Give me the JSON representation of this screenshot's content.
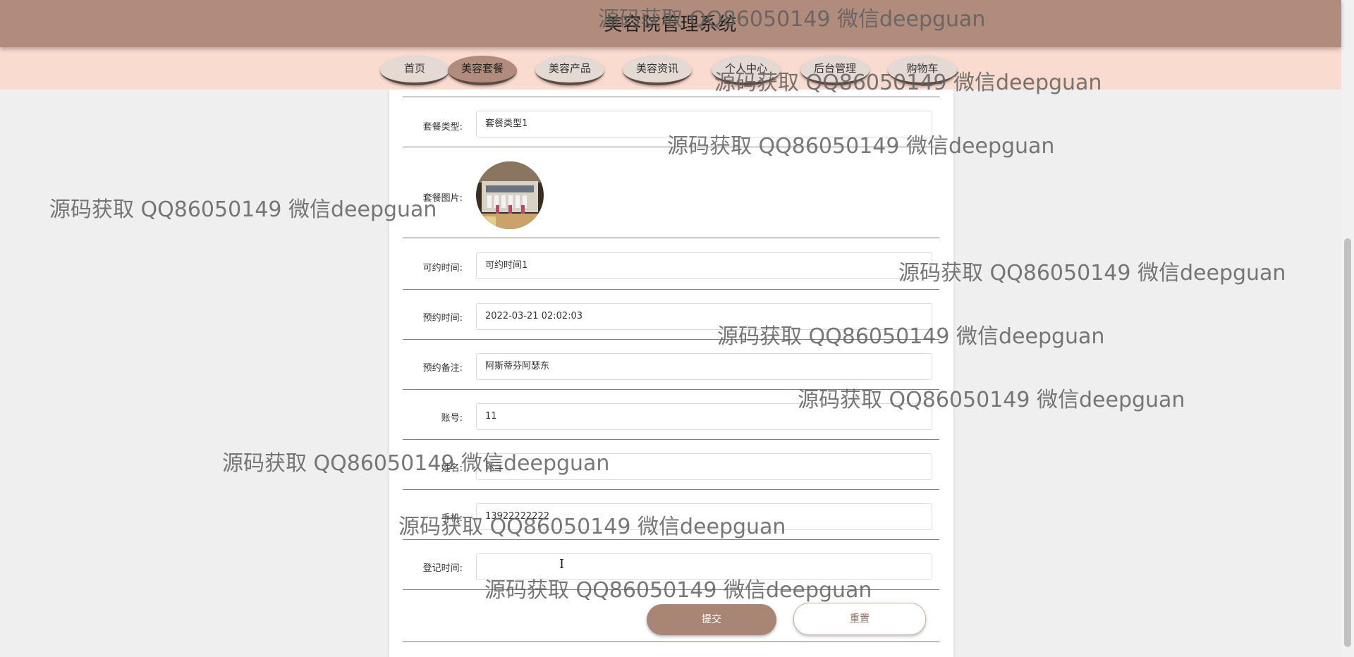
{
  "app": {
    "title": "美容院管理系统"
  },
  "nav": {
    "items": [
      {
        "label": "首页",
        "active": false
      },
      {
        "label": "美容套餐",
        "active": true
      },
      {
        "label": "美容产品",
        "active": false
      },
      {
        "label": "美容资讯",
        "active": false
      },
      {
        "label": "个人中心",
        "active": false
      },
      {
        "label": "后台管理",
        "active": false
      },
      {
        "label": "购物车",
        "active": false
      }
    ]
  },
  "form": {
    "package_type": {
      "label": "套餐类型:",
      "value": "套餐类型1"
    },
    "package_image": {
      "label": "套餐图片:"
    },
    "available_time": {
      "label": "可约时间:",
      "value": "可约时间1"
    },
    "booking_time": {
      "label": "预约时间:",
      "value": "2022-03-21 02:02:03"
    },
    "booking_note": {
      "label": "预约备注:",
      "value": "阿斯蒂芬阿瑟东"
    },
    "account": {
      "label": "账号:",
      "value": "11"
    },
    "name": {
      "label": "姓名:",
      "value": "张三"
    },
    "phone": {
      "label": "手机:",
      "value": "13922222222"
    },
    "register_time": {
      "label": "登记时间:",
      "value": ""
    },
    "submit_label": "提交",
    "reset_label": "重置"
  },
  "watermark": {
    "text": "源码获取 QQ86050149 微信deepguan"
  },
  "colors": {
    "header": "#b18b7b",
    "navbar": "#fadbd0",
    "accent": "#a98575",
    "background": "#efefef"
  }
}
